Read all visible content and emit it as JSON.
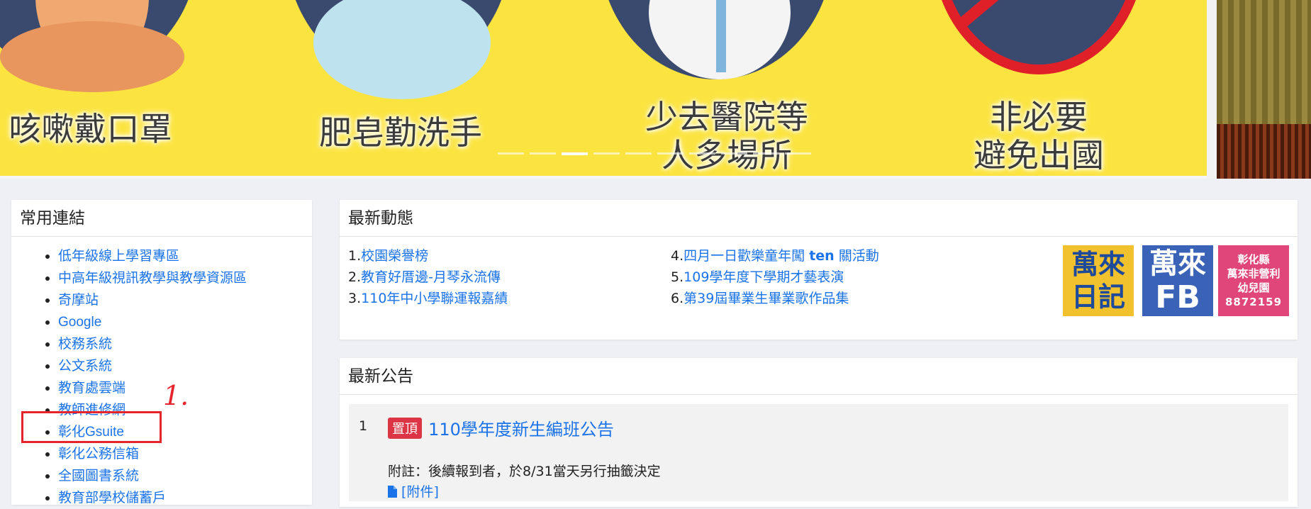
{
  "banner": {
    "captions": [
      "咳嗽戴口罩",
      "肥皂勤洗手",
      "少去醫院等\n人多場所",
      "非必要\n避免出國"
    ],
    "slide_count": 10,
    "active_slide": 3
  },
  "links_panel": {
    "title": "常用連結",
    "items": [
      "低年級線上學習專區",
      "中高年級視訊教學與教學資源區",
      "奇摩站",
      "Google",
      "校務系統",
      "公文系統",
      "教育處雲端",
      "教師進修網",
      "彰化Gsuite",
      "彰化公務信箱",
      "全國圖書系統",
      "教育部學校儲蓄戶"
    ]
  },
  "news_panel": {
    "title": "最新動態",
    "items": [
      {
        "num": "1.",
        "text": "校園榮譽榜"
      },
      {
        "num": "2.",
        "text": "教育好厝邊-月琴永流傳"
      },
      {
        "num": "3.",
        "text": "110年中小學聯運報嘉績"
      },
      {
        "num": "4.",
        "text_pre": "四月一日歡樂童年闖 ",
        "text_bold": "ten",
        "text_post": " 關活動"
      },
      {
        "num": "5.",
        "text": "109學年度下學期才藝表演"
      },
      {
        "num": "6.",
        "text": "第39屆畢業生畢業歌作品集"
      }
    ],
    "badges": [
      {
        "line1": "萬來",
        "line2": "日記",
        "color": "#f2c12e",
        "text_color": "#1d4a9a"
      },
      {
        "line1": "萬來",
        "line2": "FB",
        "color": "#3a63b8",
        "text_color": "#ffffff"
      },
      {
        "line1": "彰化縣",
        "line2": "萬來非營利",
        "line3": "幼兒園",
        "line4": "8872159",
        "color": "#e0467a",
        "text_color": "#ffffff"
      }
    ]
  },
  "announcements_panel": {
    "title": "最新公告",
    "items": [
      {
        "index": "1",
        "tag": "置頂",
        "title": "110學年度新生編班公告",
        "note": "附註：後續報到者，於8/31當天另行抽籤決定",
        "attachment": "[附件]"
      }
    ]
  },
  "annotation": {
    "mark": "1.",
    "color": "#e5242b"
  }
}
